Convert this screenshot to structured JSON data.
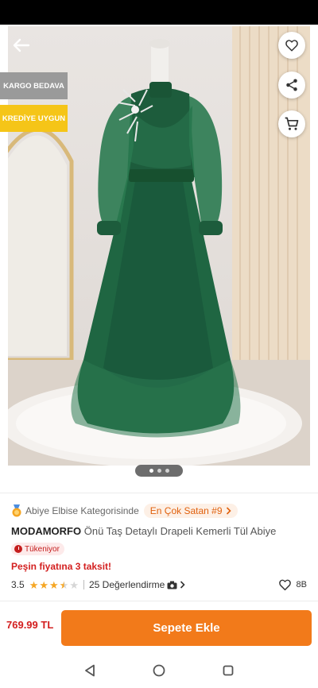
{
  "tags": {
    "shipping": "KARGO BEDAVA",
    "credit": "KREDİYE UYGUN"
  },
  "icons": {
    "back": "arrow-left-icon",
    "favorite": "heart-icon",
    "share": "share-icon",
    "cart": "cart-icon"
  },
  "gallery": {
    "dot_count": 3,
    "active_dot": 1
  },
  "product": {
    "category_text": "Abiye Elbise Kategorisinde",
    "best_seller": "En Çok Satan #9",
    "brand": "MODAMORFO",
    "name": "Önü Taş Detaylı Drapeli Kemerli Tül Abiye",
    "stock_status": "Tükeniyor",
    "installment_text": "Peşin fiyatına 3 taksit!",
    "rating": "3.5",
    "rating_value": 3.5,
    "reviews_text": "25 Değerlendirme",
    "likes": "8B"
  },
  "bottom": {
    "price": "769.99 TL",
    "add_to_cart": "Sepete Ekle"
  },
  "colors": {
    "accent": "#f27a1a",
    "price_red": "#d32020",
    "dress_green": "#1d5c3c"
  }
}
